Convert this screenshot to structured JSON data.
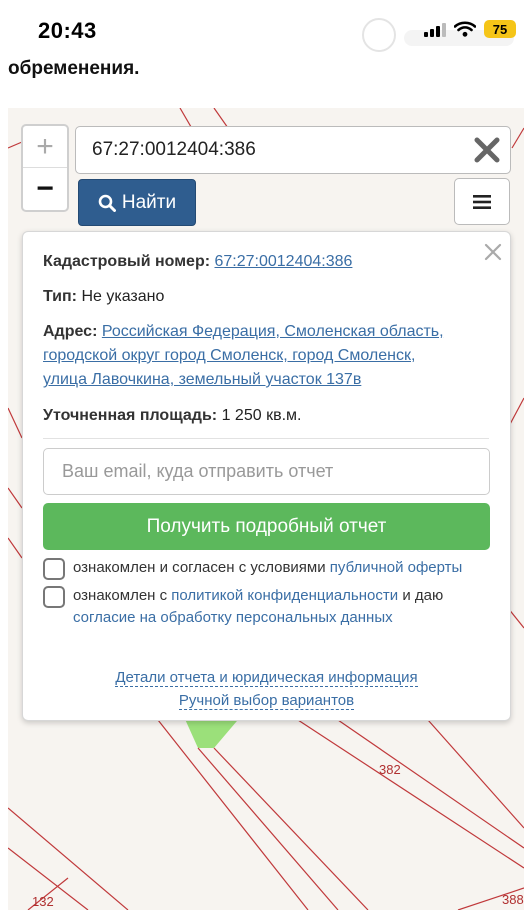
{
  "status_bar": {
    "time": "20:43",
    "battery": "75"
  },
  "page": {
    "fragment_text": "обременения."
  },
  "search": {
    "value": "67:27:0012404:386",
    "find_label": "Найти"
  },
  "zoom": {
    "in_label": "+",
    "out_label": "−"
  },
  "popup": {
    "cadastral_label": "Кадастровый номер:",
    "cadastral_value": "67:27:0012404:386",
    "type_label": "Тип:",
    "type_value": "Не указано",
    "address_label": "Адрес:",
    "address_line1": "Российская Федерация, Смоленская область,",
    "address_line2": "городской округ город Смоленск, город Смоленск,",
    "address_line3": "улица Лавочкина, земельный участок 137в",
    "area_label": "Уточненная площадь:",
    "area_value": "1 250 кв.м.",
    "email_placeholder": "Ваш email, куда отправить отчет",
    "report_button": "Получить подробный отчет",
    "consent1_text": "ознакомлен и согласен с условиями",
    "consent1_link": "публичной оферты",
    "consent2_text1": "ознакомлен с",
    "consent2_link1": "политикой конфиденциальности",
    "consent2_text2": "и даю",
    "consent2_link2": "согласие на обработку персональных данных",
    "details_link": "Детали отчета и юридическая информация",
    "manual_link": "Ручной выбор вариантов"
  },
  "map": {
    "labels": [
      "382",
      "132",
      "388"
    ],
    "line_color": "#c0393b",
    "parcel_color": "#9be07a"
  },
  "icons": {
    "search": "search-icon",
    "clear": "close-x-icon",
    "menu": "hamburger-menu-icon",
    "popup_close": "close-icon"
  }
}
